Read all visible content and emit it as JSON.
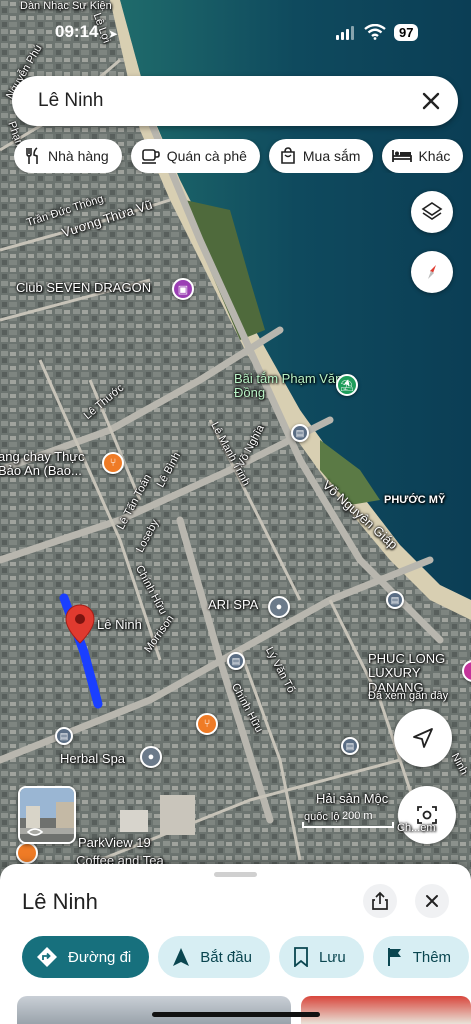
{
  "status_bar": {
    "time": "09:14",
    "battery": "97"
  },
  "search": {
    "query": "Lê Ninh"
  },
  "chips": [
    {
      "label": "Nhà hàng",
      "icon": "restaurant-icon"
    },
    {
      "label": "Quán cà phê",
      "icon": "coffee-icon"
    },
    {
      "label": "Mua sắm",
      "icon": "shopping-bag-icon"
    },
    {
      "label": "Khác",
      "icon": "hotel-icon"
    }
  ],
  "map": {
    "streets": {
      "dan_nhac": "Dàn Nhạc Sự Kiện",
      "le_loi": "Lê Lợi",
      "nguyen_phu": "Nguyễn Phú",
      "pham_van": "Phạm Văn",
      "tran_duc_thong": "Trần Đức Thông",
      "vuong_thua_vu": "Vương Thừa Vũ",
      "le_thuoc": "Lê Thước",
      "le_manh_trinh": "Lê Mạnh Trinh",
      "vo_nghia": "Võ Nghĩa",
      "le_binh": "Lê Bình",
      "le_tan_toan": "Lê Tấn Toán",
      "loseby": "Loseby",
      "chinh_huu": "Chính Hữu",
      "morrison": "Morrison",
      "ly_van_to": "Lý Văn Tố",
      "chinh_huu_2": "Chính Hữu",
      "vo_nguyen_giap": "Võ Nguyên Giáp",
      "le_ninh_road": "Lê Ninh",
      "phuoc_my": "PHƯỚC MỸ",
      "ninh_edge": "Ninh",
      "quoc_label": "quốc lộ"
    },
    "places": {
      "club": "Club SEVEN DRAGON",
      "beach": "Bãi tắm Phạm Văn Đồng",
      "restaurant_left": "ang chay Thực Bảo An (Bao...",
      "ari_spa": "ARI SPA",
      "phuc_long": "PHUC LONG LUXURY DANANG",
      "phuc_long_sub": "Đã xem gần đây",
      "herbal_spa": "Herbal Spa",
      "hai_san": "Hải sản Mộc",
      "parkview": "ParkView 19",
      "coffee": "Coffee and Tea"
    },
    "scale_label": "200 m",
    "lens_label": "Ch...em",
    "colors": {
      "route": "#1a3fff",
      "pin": "#e03a2f",
      "poi_orange": "#ef7b26",
      "poi_green": "#1e9c5a",
      "poi_purple": "#9b3fb4"
    }
  },
  "sheet": {
    "title": "Lê Ninh",
    "actions": [
      {
        "label": "Đường đi",
        "icon": "directions-icon"
      },
      {
        "label": "Bắt đầu",
        "icon": "navigation-icon"
      },
      {
        "label": "Lưu",
        "icon": "bookmark-icon"
      },
      {
        "label": "Thêm",
        "icon": "flag-icon"
      }
    ]
  }
}
